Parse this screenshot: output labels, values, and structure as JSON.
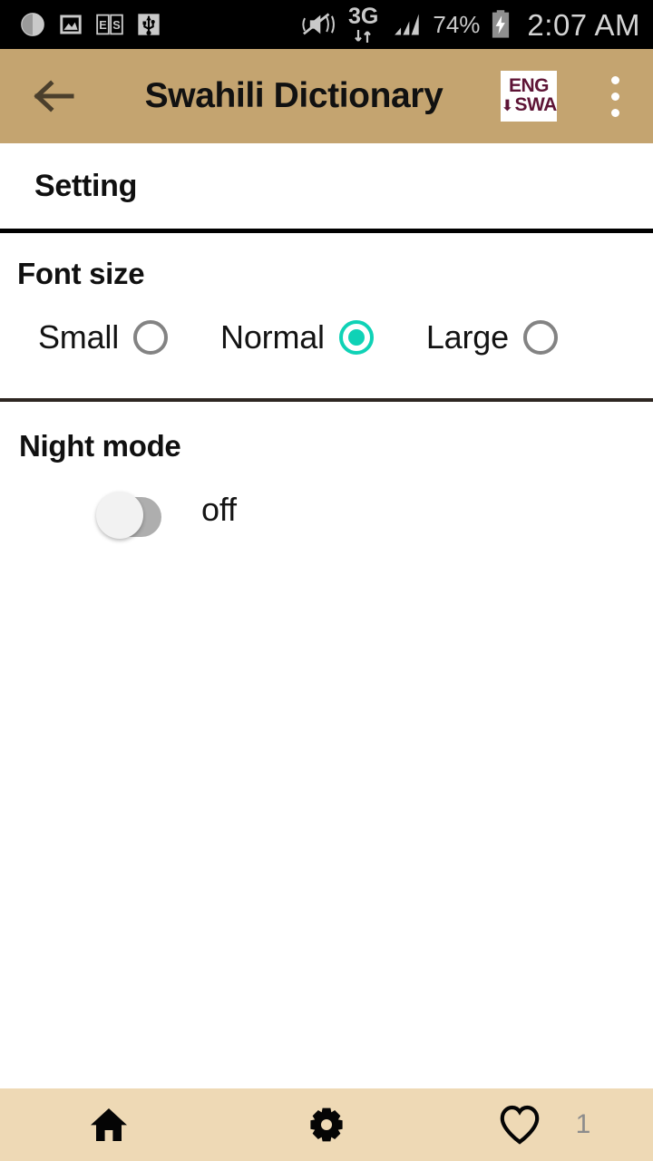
{
  "status_bar": {
    "icons_left": [
      "contrast-icon",
      "image-icon",
      "es-dictionary-icon",
      "usb-icon"
    ],
    "sound_icon": "mute-vibrate-icon",
    "network_label": "3G",
    "data_arrows_icon": "data-transfer-icon",
    "signal_icon": "signal-bars-icon",
    "battery_percent": "74%",
    "battery_icon": "battery-charging-icon",
    "clock": "2:07 AM"
  },
  "app_bar": {
    "back_icon": "back-arrow-icon",
    "title": "Swahili Dictionary",
    "logo": {
      "top": "ENG",
      "arrow": "⬇",
      "bottom": "SWA"
    },
    "overflow_icon": "overflow-menu-icon"
  },
  "page": {
    "title": "Setting"
  },
  "font_size": {
    "label": "Font size",
    "options": [
      {
        "label": "Small",
        "selected": false
      },
      {
        "label": "Normal",
        "selected": true
      },
      {
        "label": "Large",
        "selected": false
      }
    ],
    "selected_value": "Normal"
  },
  "night_mode": {
    "label": "Night mode",
    "state_text": "off",
    "enabled": false
  },
  "bottom_nav": {
    "items": [
      {
        "name": "home",
        "icon": "home-icon",
        "label": ""
      },
      {
        "name": "settings",
        "icon": "gear-icon",
        "label": ""
      },
      {
        "name": "favorites",
        "icon": "heart-icon",
        "label": "1"
      }
    ],
    "favorites_count": "1"
  },
  "colors": {
    "app_bar": "#c4a470",
    "bottom_nav": "#eed9b5",
    "accent_teal": "#0fd2b6",
    "logo_maroon": "#5e1436",
    "status_bar": "#000000"
  }
}
